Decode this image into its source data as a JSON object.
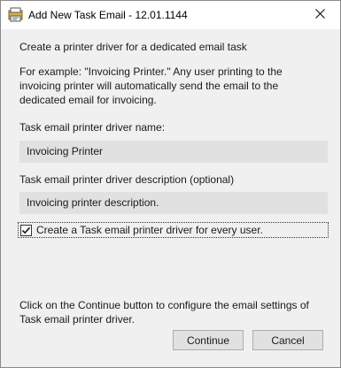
{
  "window": {
    "title": "Add New Task Email - 12.01.1144",
    "app_icon": "task-email-app-icon",
    "close_icon": "close-icon"
  },
  "content": {
    "intro": "Create a printer driver for a dedicated email task",
    "example": "For example: \"Invoicing Printer.\" Any user printing to the invoicing printer will automatically send the email to the dedicated email for invoicing.",
    "name_label": "Task email printer driver name:",
    "name_value": "Invoicing Printer",
    "description_label": "Task email printer driver description (optional)",
    "description_value": "Invoicing printer description.",
    "checkbox_label": "Create a Task email printer driver for every user.",
    "checkbox_checked": true,
    "footer": "Click on the Continue button to configure the email settings of Task email printer driver."
  },
  "buttons": {
    "continue_label": "Continue",
    "cancel_label": "Cancel"
  }
}
